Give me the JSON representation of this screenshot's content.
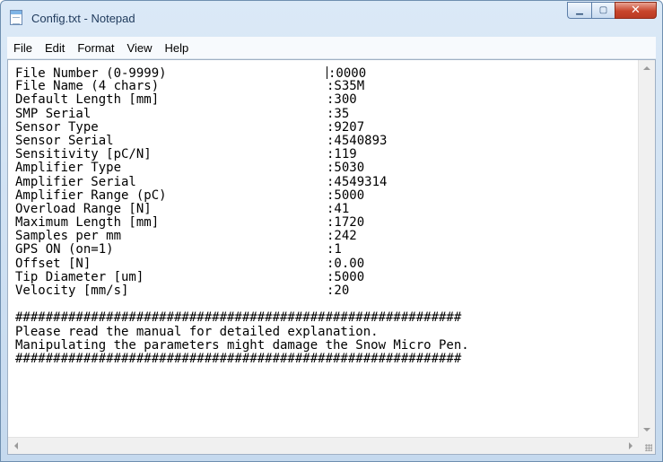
{
  "window": {
    "title": "Config.txt - Notepad",
    "icon": "notepad-icon",
    "controls": {
      "minimize": "minimize-icon",
      "maximize": "maximize-icon",
      "close": "close-icon"
    }
  },
  "menu": [
    "File",
    "Edit",
    "Format",
    "View",
    "Help"
  ],
  "editor": {
    "fields": [
      {
        "label": "File Number (0-9999)",
        "value": ":0000"
      },
      {
        "label": "File Name (4 chars)",
        "value": ":S35M"
      },
      {
        "label": "Default Length [mm]",
        "value": ":300"
      },
      {
        "label": "SMP Serial",
        "value": ":35"
      },
      {
        "label": "Sensor Type",
        "value": ":9207"
      },
      {
        "label": "Sensor Serial",
        "value": ":4540893"
      },
      {
        "label": "Sensitivity [pC/N]",
        "value": ":119"
      },
      {
        "label": "Amplifier Type",
        "value": ":5030"
      },
      {
        "label": "Amplifier Serial",
        "value": ":4549314"
      },
      {
        "label": "Amplifier Range (pC)",
        "value": ":5000"
      },
      {
        "label": "Overload Range [N]",
        "value": ":41"
      },
      {
        "label": "Maximum Length [mm]",
        "value": ":1720"
      },
      {
        "label": "Samples per mm",
        "value": ":242"
      },
      {
        "label": "GPS ON (on=1)",
        "value": ":1"
      },
      {
        "label": "Offset [N]",
        "value": ":0.00"
      },
      {
        "label": "Tip Diameter [um]",
        "value": ":5000"
      },
      {
        "label": "Velocity [mm/s]",
        "value": ":20"
      }
    ],
    "footer": [
      "###########################################################",
      "Please read the manual for detailed explanation.",
      "Manipulating the parameters might damage the Snow Micro Pen.",
      "###########################################################"
    ]
  }
}
